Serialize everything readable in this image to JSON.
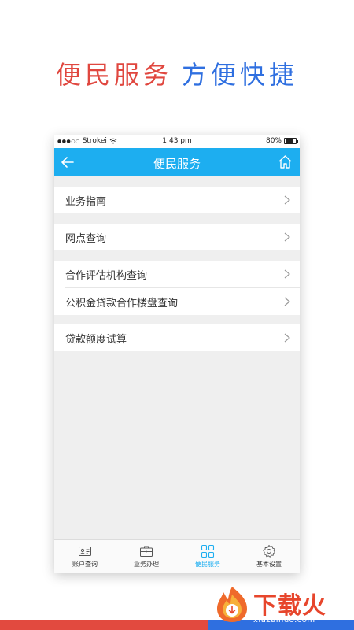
{
  "headline": {
    "part1": "便民服务",
    "part2": "方便快捷"
  },
  "status_bar": {
    "carrier": "Strokei",
    "time": "1:43 pm",
    "battery": "80%",
    "battery_level": 0.8
  },
  "nav": {
    "title": "便民服务",
    "back_icon": "arrow-left-icon",
    "home_icon": "home-icon"
  },
  "menu_groups": [
    {
      "items": [
        "业务指南"
      ]
    },
    {
      "items": [
        "网点查询"
      ]
    },
    {
      "items": [
        "合作评估机构查询",
        "公积金贷款合作楼盘查询"
      ]
    },
    {
      "items": [
        "贷款额度试算"
      ]
    }
  ],
  "tabs": [
    {
      "label": "账户查询",
      "icon": "id-card-icon",
      "active": false
    },
    {
      "label": "业务办理",
      "icon": "briefcase-icon",
      "active": false
    },
    {
      "label": "便民服务",
      "icon": "grid-icon",
      "active": true
    },
    {
      "label": "基本设置",
      "icon": "gear-icon",
      "active": false
    }
  ],
  "logo": {
    "text": "下载火",
    "url": "xiazaihuo.com"
  },
  "colors": {
    "accent": "#1daef0",
    "headline_red": "#e0473f",
    "headline_blue": "#2f6fe0",
    "logo_red": "#e7462c"
  }
}
